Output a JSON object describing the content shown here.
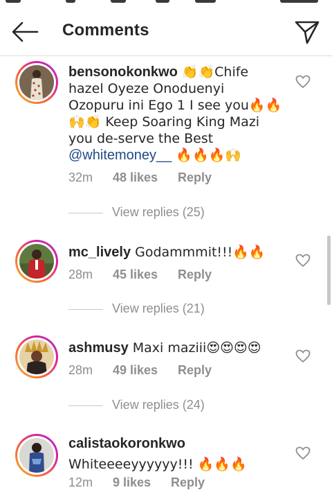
{
  "header": {
    "title": "Comments"
  },
  "comments": [
    {
      "username": "bensonokonkwo",
      "text_a": " 👏👏Chife hazel Oyeze Onoduenyi  Ozopuru ini Ego 1 I see you🔥🔥🙌👏 Keep Soaring King Mazi you de-serve the Best ",
      "mention": "@whitemoney__",
      "text_b": " 🔥🔥🔥🙌",
      "time": "32m",
      "likes": "48 likes",
      "reply": "Reply",
      "view_replies": "View replies (25)"
    },
    {
      "username": "mc_lively",
      "text_a": " Godammmit!!!🔥🔥",
      "time": "28m",
      "likes": "45 likes",
      "reply": "Reply",
      "view_replies": "View replies (21)"
    },
    {
      "username": "ashmusy",
      "text_a": " Maxi maziii😍😍😍😍",
      "time": "28m",
      "likes": "49 likes",
      "reply": "Reply",
      "view_replies": "View replies (24)"
    },
    {
      "username": "calistaokoronkwo",
      "text_a": "Whiteeeeyyyyyy!!! 🔥🔥🔥",
      "time": "12m",
      "likes": "9 likes",
      "reply": "Reply"
    }
  ],
  "icons": {
    "back": "arrow-left-icon",
    "share": "paper-plane-icon",
    "like": "heart-outline-icon"
  },
  "colors": {
    "text": "#262626",
    "muted": "#8e8e8e",
    "mention": "#1e4a86",
    "story_ring": "#d6249f"
  }
}
